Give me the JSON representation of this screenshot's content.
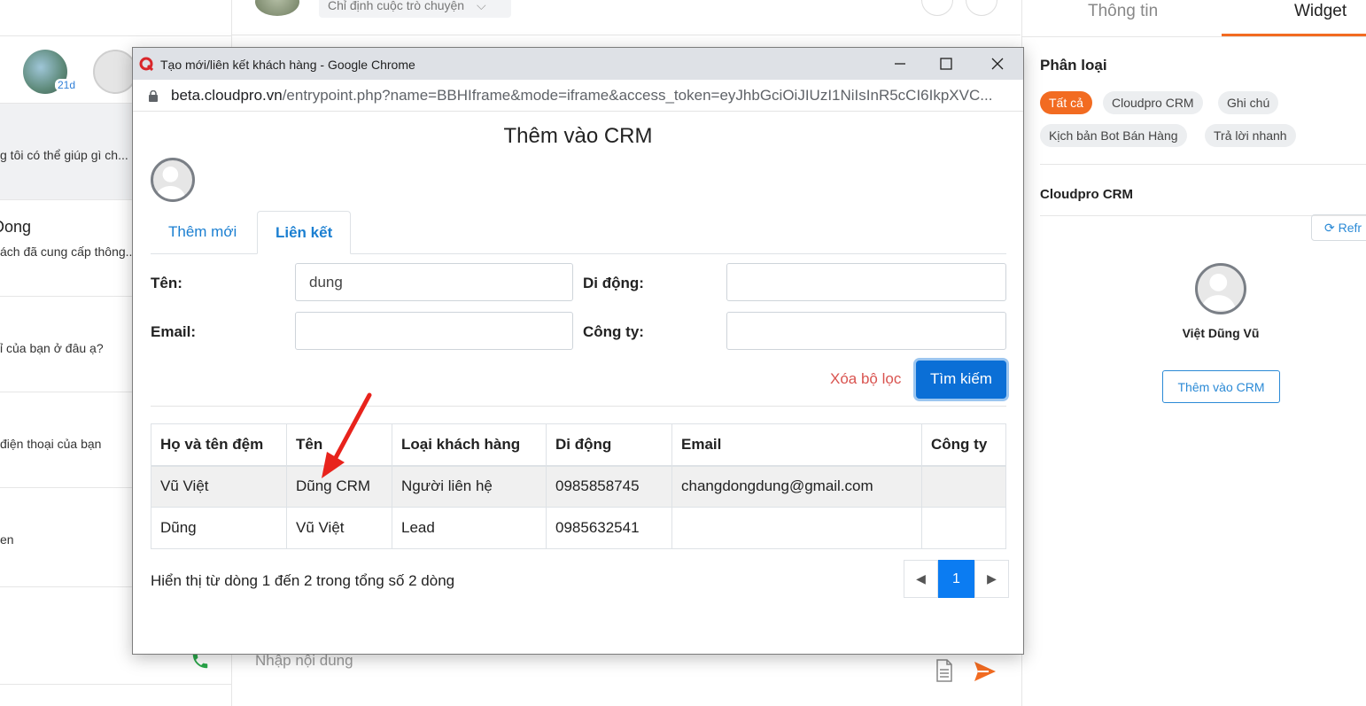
{
  "left": {
    "badge": "21d",
    "conversations": [
      {
        "name": "",
        "msg": "g tôi có thể giúp gì ch..."
      },
      {
        "name": "Dong",
        "msg": "ách đã cung cấp thông..."
      },
      {
        "name": "",
        "msg": "ỉ của bạn ở đâu ạ?"
      },
      {
        "name": "",
        "msg": "điện thoại của bạn"
      },
      {
        "name": "",
        "msg": "en"
      }
    ]
  },
  "middle": {
    "assign_label": "Chỉ định cuộc trò chuyện",
    "compose_placeholder": "Nhập nội dung"
  },
  "right": {
    "tabs": [
      "Thông tin",
      "Widget"
    ],
    "active_tab": "Widget",
    "category_title": "Phân loại",
    "chips": [
      "Tất cả",
      "Cloudpro CRM",
      "Ghi chú",
      "Kịch bản Bot Bán Hàng",
      "Trả lời nhanh"
    ],
    "section_title": "Cloudpro CRM",
    "refresh_label": "Refr",
    "contact_name": "Việt Dũng Vũ",
    "add_crm_label": "Thêm vào CRM"
  },
  "popup": {
    "window_title": "Tạo mới/liên kết khách hàng - Google Chrome",
    "url_domain": "beta.cloudpro.vn",
    "url_rest": "/entrypoint.php?name=BBHIframe&mode=iframe&access_token=eyJhbGciOiJIUzI1NiIsInR5cCI6IkpXVC...",
    "page_title": "Thêm vào CRM",
    "tabs": [
      "Thêm mới",
      "Liên kết"
    ],
    "active_tab": "Liên kết",
    "form": {
      "name_label": "Tên:",
      "name_value": "dung",
      "mobile_label": "Di động:",
      "mobile_value": "",
      "email_label": "Email:",
      "email_value": "",
      "company_label": "Công ty:",
      "company_value": ""
    },
    "clear_filter": "Xóa bộ lọc",
    "search_button": "Tìm kiếm",
    "table": {
      "headers": [
        "Họ và tên đệm",
        "Tên",
        "Loại khách hàng",
        "Di động",
        "Email",
        "Công ty"
      ],
      "rows": [
        [
          "Vũ Việt",
          "Dũng CRM",
          "Người liên hệ",
          "0985858745",
          "changdongdung@gmail.com",
          ""
        ],
        [
          "Dũng",
          "Vũ Việt",
          "Lead",
          "0985632541",
          "",
          ""
        ]
      ]
    },
    "footer_info": "Hiển thị từ dòng 1 đến 2 trong tổng số 2 dòng",
    "pagination": {
      "current": "1"
    }
  },
  "colors": {
    "accent_orange": "#f26b21",
    "primary_blue": "#0b6fd6",
    "link_blue": "#1b7fd1",
    "danger": "#d9534f",
    "arrow_red": "#e8231c"
  }
}
